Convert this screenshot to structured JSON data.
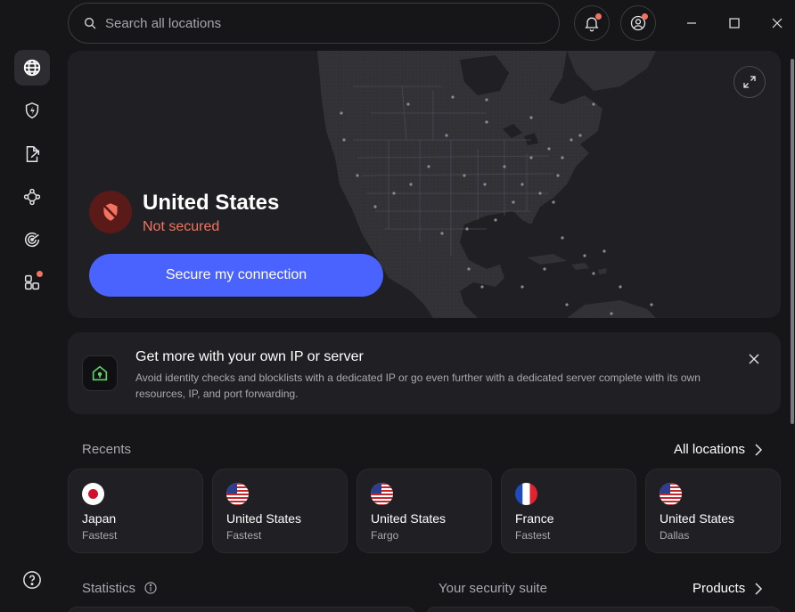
{
  "search": {
    "placeholder": "Search all locations"
  },
  "sidebar": {
    "items": [
      {
        "name": "globe-icon",
        "active": true
      },
      {
        "name": "shield-bolt-icon"
      },
      {
        "name": "file-export-icon"
      },
      {
        "name": "mesh-icon"
      },
      {
        "name": "radar-icon"
      },
      {
        "name": "apps-icon",
        "badge": true
      }
    ],
    "help_icon": "help-icon"
  },
  "top": {
    "notifications_icon": "bell-icon",
    "account_icon": "account-icon"
  },
  "map": {
    "country": "United States",
    "status": "Not secured",
    "cta": "Secure my connection",
    "status_color": "#f2735f",
    "cta_color": "#4a63ff"
  },
  "promo": {
    "title": "Get more with your own IP or server",
    "text": "Avoid identity checks and blocklists with a dedicated IP or go even further with a dedicated server complete with its own resources, IP, and port forwarding."
  },
  "recents": {
    "label": "Recents",
    "all_locations": "All locations",
    "items": [
      {
        "country": "Japan",
        "sub": "Fastest",
        "flag": "jp"
      },
      {
        "country": "United States",
        "sub": "Fastest",
        "flag": "us"
      },
      {
        "country": "United States",
        "sub": "Fargo",
        "flag": "us"
      },
      {
        "country": "France",
        "sub": "Fastest",
        "flag": "fr"
      },
      {
        "country": "United States",
        "sub": "Dallas",
        "flag": "us"
      }
    ]
  },
  "statistics": {
    "label": "Statistics"
  },
  "suite": {
    "label": "Your security suite",
    "products": "Products"
  }
}
